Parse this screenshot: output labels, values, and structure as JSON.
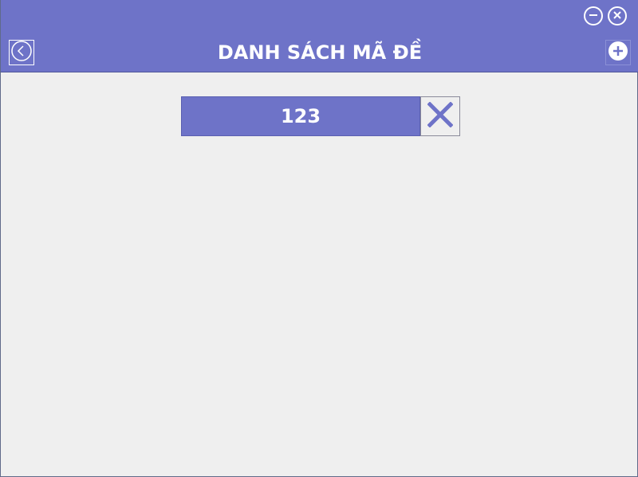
{
  "window": {
    "title": "DANH SÁCH MÃ ĐỀ",
    "minimize_icon": "minus-circle-icon",
    "close_icon": "x-circle-icon",
    "back_icon": "chevron-left-circle-icon",
    "add_icon": "plus-circle-icon"
  },
  "list": {
    "items": [
      {
        "code": "123",
        "delete_icon": "x-icon"
      }
    ]
  },
  "colors": {
    "accent": "#6e73c8",
    "background": "#efefef",
    "text_on_accent": "#ffffff"
  }
}
